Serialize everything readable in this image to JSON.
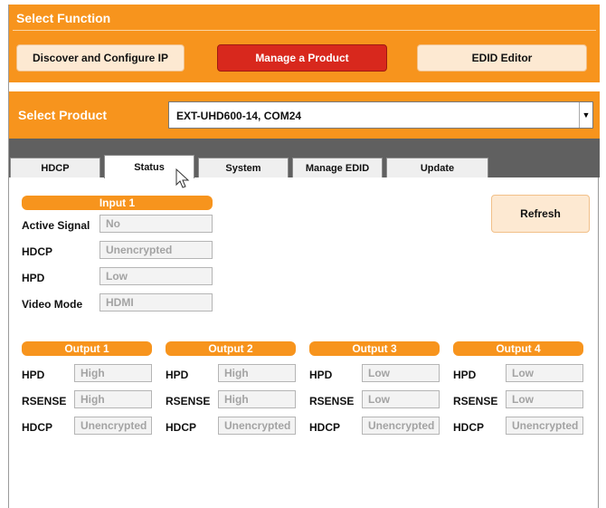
{
  "select_function": {
    "title": "Select Function",
    "buttons": [
      {
        "label": "Discover and Configure IP",
        "active": false
      },
      {
        "label": "Manage a Product",
        "active": true
      },
      {
        "label": "EDID Editor",
        "active": false
      }
    ]
  },
  "select_product": {
    "label": "Select Product",
    "value": "EXT-UHD600-14, COM24"
  },
  "tabs": [
    {
      "label": "HDCP",
      "selected": false
    },
    {
      "label": "Status",
      "selected": true
    },
    {
      "label": "System",
      "selected": false
    },
    {
      "label": "Manage EDID",
      "selected": false
    },
    {
      "label": "Update",
      "selected": false
    }
  ],
  "input": {
    "header": "Input 1",
    "rows": [
      {
        "label": "Active Signal",
        "value": "No"
      },
      {
        "label": "HDCP",
        "value": "Unencrypted"
      },
      {
        "label": "HPD",
        "value": "Low"
      },
      {
        "label": "Video Mode",
        "value": "HDMI"
      }
    ]
  },
  "refresh_label": "Refresh",
  "outputs": [
    {
      "header": "Output 1",
      "rows": [
        {
          "label": "HPD",
          "value": "High"
        },
        {
          "label": "RSENSE",
          "value": "High"
        },
        {
          "label": "HDCP",
          "value": "Unencrypted"
        }
      ]
    },
    {
      "header": "Output 2",
      "rows": [
        {
          "label": "HPD",
          "value": "High"
        },
        {
          "label": "RSENSE",
          "value": "High"
        },
        {
          "label": "HDCP",
          "value": "Unencrypted"
        }
      ]
    },
    {
      "header": "Output 3",
      "rows": [
        {
          "label": "HPD",
          "value": "Low"
        },
        {
          "label": "RSENSE",
          "value": "Low"
        },
        {
          "label": "HDCP",
          "value": "Unencrypted"
        }
      ]
    },
    {
      "header": "Output 4",
      "rows": [
        {
          "label": "HPD",
          "value": "Low"
        },
        {
          "label": "RSENSE",
          "value": "Low"
        },
        {
          "label": "HDCP",
          "value": "Unencrypted"
        }
      ]
    }
  ],
  "colors": {
    "accent_orange": "#f7941d",
    "active_red": "#d8281d",
    "button_cream": "#fde9d2",
    "tab_strip_gray": "#606060"
  }
}
